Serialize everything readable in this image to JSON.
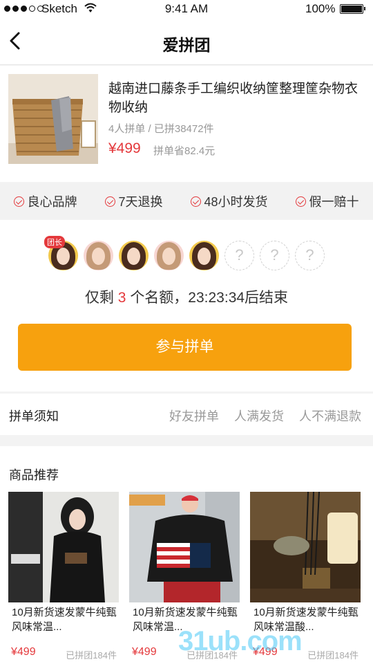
{
  "status_bar": {
    "carrier": "Sketch",
    "time": "9:41 AM",
    "battery": "100%"
  },
  "nav": {
    "title": "爱拼团"
  },
  "product": {
    "name": "越南进口藤条手工编织收纳筐整理筐杂物衣物收纳",
    "group_info": "4人拼单 / 已拼38472件",
    "price": "¥499",
    "saving": "拼单省82.4元"
  },
  "guarantees": [
    "良心品牌",
    "7天退换",
    "48小时发货",
    "假一赔十"
  ],
  "group": {
    "leader_badge": "团长",
    "empty_slot": "?",
    "remain_prefix": "仅剩",
    "remain_count": "3",
    "remain_suffix": "个名额，23:23:34后结束",
    "join_button": "参与拼单"
  },
  "rules": {
    "label": "拼单须知",
    "items": [
      "好友拼单",
      "人满发货",
      "人不满退款"
    ]
  },
  "recommend": {
    "title": "商品推荐",
    "items": [
      {
        "name": "10月新货速发蒙牛纯甄风味常温...",
        "price": "¥499",
        "sold": "已拼团184件"
      },
      {
        "name": "10月新货速发蒙牛纯甄风味常温...",
        "price": "¥499",
        "sold": "已拼团184件"
      },
      {
        "name": "10月新货速发蒙牛纯甄风味常温酸...",
        "price": "¥499",
        "sold": "已拼团184件"
      }
    ]
  },
  "watermark": "31ub.com",
  "colors": {
    "accent_red": "#e4393c",
    "join_orange": "#f7a10e"
  }
}
